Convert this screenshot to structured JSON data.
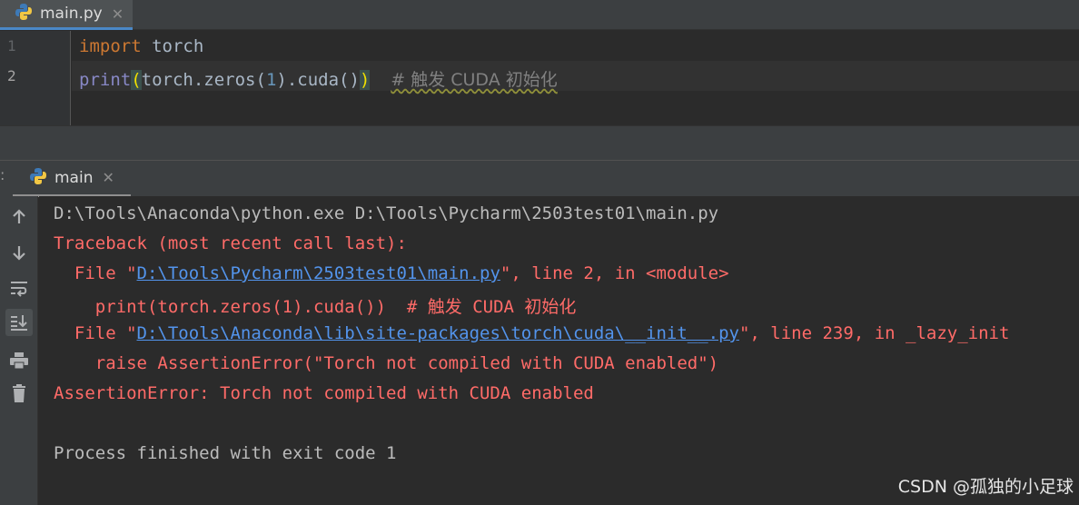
{
  "editor": {
    "tab": {
      "label": "main.py",
      "close": "✕"
    },
    "lines": [
      {
        "number": "1",
        "keyword": "import",
        "rest": " torch"
      },
      {
        "number": "2",
        "func": "print",
        "open": "(",
        "mid": "torch.zeros(",
        "num": "1",
        "tail": ").cuda()",
        "close": ")",
        "comment": "# 触发 CUDA 初始化"
      }
    ]
  },
  "run": {
    "dots": ":",
    "tab": {
      "label": "main",
      "close": "✕"
    },
    "toolbar": [
      "arrow-up-icon",
      "arrow-down-icon",
      "soft-wrap-icon",
      "scroll-to-end-icon",
      "print-icon",
      "trash-icon"
    ],
    "console": {
      "command": "D:\\Tools\\Anaconda\\python.exe D:\\Tools\\Pycharm\\2503test01\\main.py",
      "traceback": "Traceback (most recent call last):",
      "frame1_prefix": "  File \"",
      "frame1_link": "D:\\Tools\\Pycharm\\2503test01\\main.py",
      "frame1_suffix": "\", line 2, in <module>",
      "frame1_code": "    print(torch.zeros(1).cuda())  # 触发 CUDA 初始化",
      "frame2_prefix": "  File \"",
      "frame2_link": "D:\\Tools\\Anaconda\\lib\\site-packages\\torch\\cuda\\__init__.py",
      "frame2_suffix": "\", line 239, in _lazy_init",
      "frame2_code": "    raise AssertionError(\"Torch not compiled with CUDA enabled\")",
      "error": "AssertionError: Torch not compiled with CUDA enabled",
      "exit": "Process finished with exit code 1"
    }
  },
  "watermark": "CSDN @孤独的小足球",
  "colors": {
    "background": "#2b2b2b",
    "error": "#ff6b68",
    "link": "#5394ec",
    "keyword": "#cc7832",
    "builtin": "#8888c6",
    "number": "#6897bb",
    "comment": "#808080"
  }
}
